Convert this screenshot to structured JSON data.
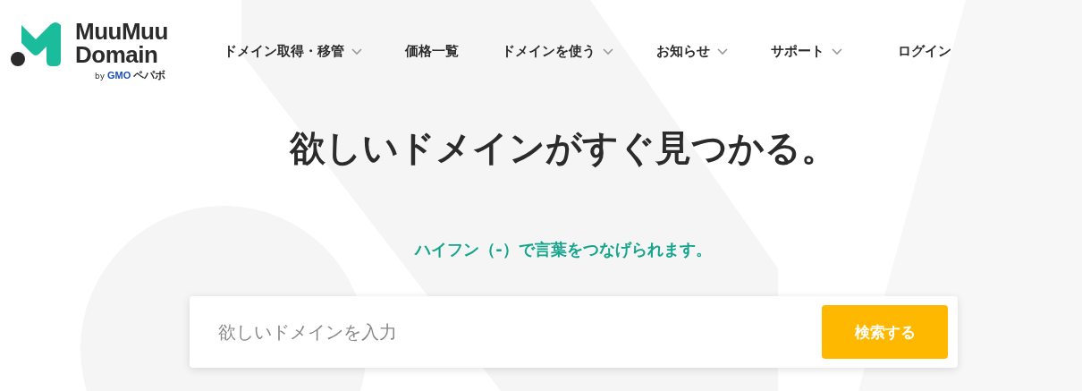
{
  "logo": {
    "line1": "MuuMuu",
    "line2": "Domain",
    "by": "by",
    "company": "GMO",
    "brand": "ペパボ"
  },
  "nav": [
    {
      "label": "ドメイン取得・移管",
      "dropdown": true
    },
    {
      "label": "価格一覧",
      "dropdown": false
    },
    {
      "label": "ドメインを使う",
      "dropdown": true
    },
    {
      "label": "お知らせ",
      "dropdown": true
    },
    {
      "label": "サポート",
      "dropdown": true
    },
    {
      "label": "ログイン",
      "dropdown": false
    }
  ],
  "hero": {
    "title": "欲しいドメインがすぐ見つかる。",
    "hint": "ハイフン（-）で言葉をつなげられます。"
  },
  "search": {
    "placeholder": "欲しいドメインを入力",
    "button": "検索する"
  }
}
